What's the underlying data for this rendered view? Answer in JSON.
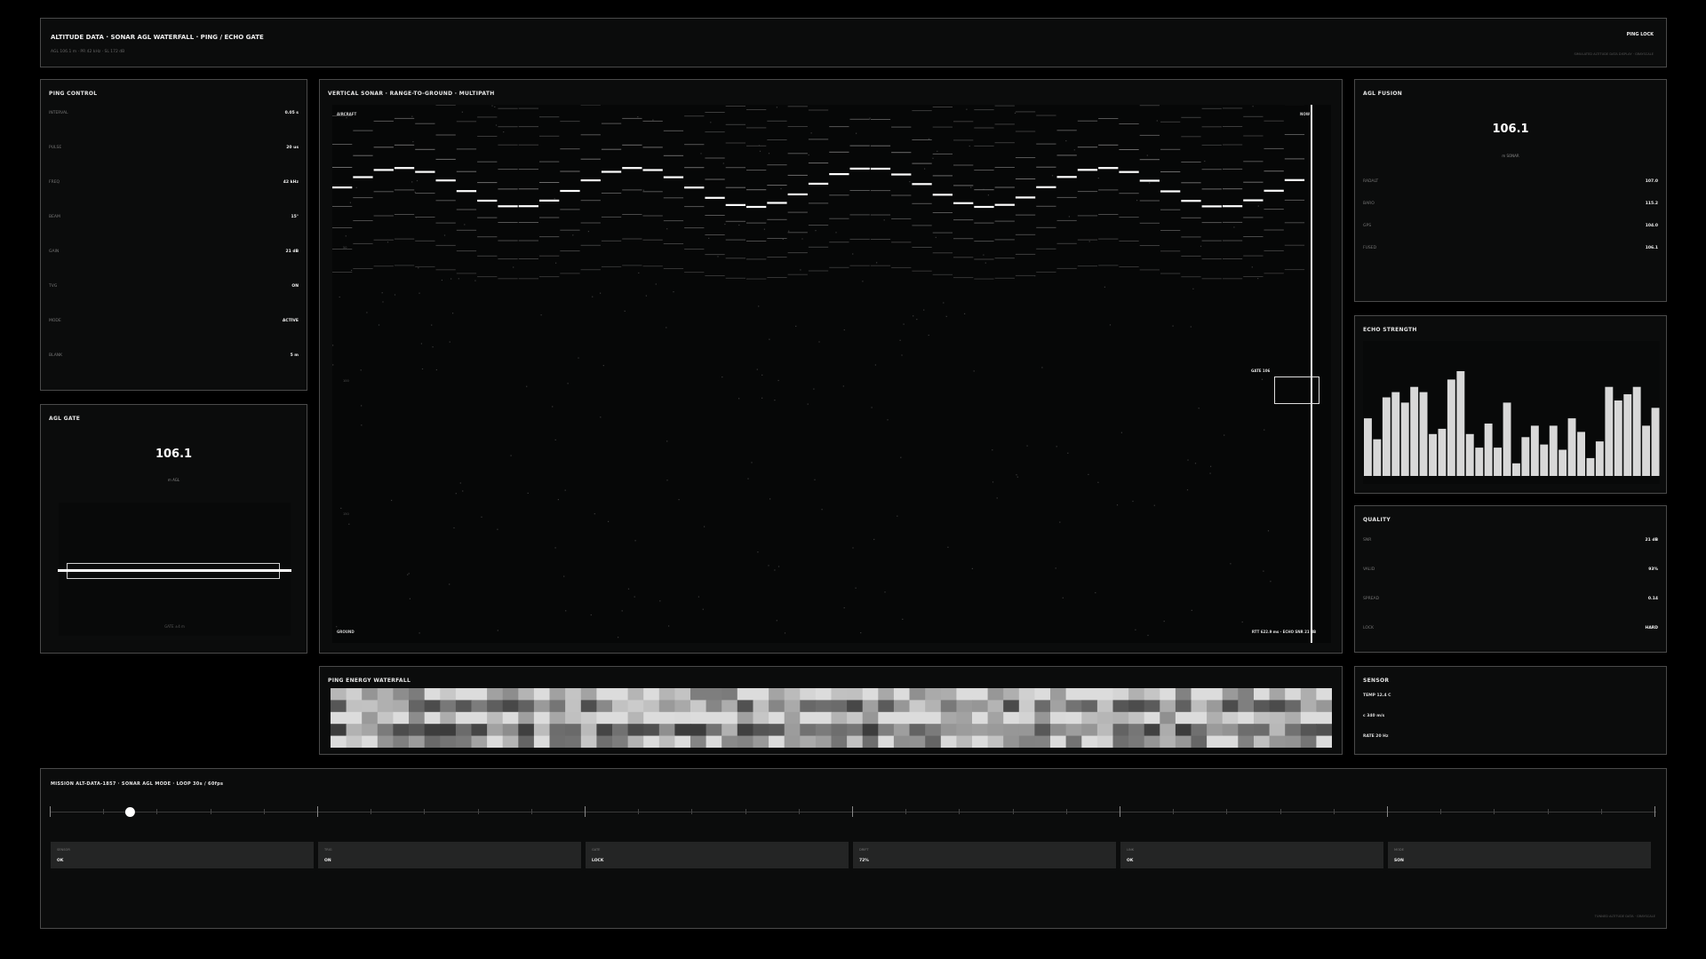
{
  "header": {
    "title": "ALTITUDE DATA · SONAR AGL WATERFALL · PING / ECHO GATE",
    "subtitle": "AGL 106.1 m · PR 42 kHz · SL 172 dB",
    "status": "PING LOCK",
    "right_caption": "SIMULATED ALTITUDE DATA DISPLAY · GRAYSCALE"
  },
  "ping_control": {
    "title": "PING CONTROL",
    "rows": [
      {
        "k": "INTERVAL",
        "v": "0.05 s"
      },
      {
        "k": "PULSE",
        "v": "20 us"
      },
      {
        "k": "FREQ",
        "v": "42 kHz"
      },
      {
        "k": "BEAM",
        "v": "15°"
      },
      {
        "k": "GAIN",
        "v": "21 dB"
      },
      {
        "k": "TVG",
        "v": "ON"
      },
      {
        "k": "MODE",
        "v": "ACTIVE"
      },
      {
        "k": "BLANK",
        "v": "5 m"
      }
    ]
  },
  "agl_gate": {
    "title": "AGL GATE",
    "value": "106.1",
    "unit": "m AGL",
    "caption": "GATE ±4 m"
  },
  "sonar": {
    "title": "VERTICAL SONAR · RANGE-TO-GROUND · MULTIPATH",
    "top_left": "AIRCRAFT",
    "top_right": "NOW",
    "bottom_left": "GROUND",
    "gate_label": "GATE 106",
    "readout": "RTT 622.9 ms · ECHO SNR 21 dB",
    "ticks": [
      "0",
      "50",
      "100",
      "150",
      "200"
    ]
  },
  "agl_fusion": {
    "title": "AGL FUSION",
    "value": "106.1",
    "unit": "m SONAR",
    "rows": [
      {
        "k": "RADALT",
        "v": "107.0"
      },
      {
        "k": "BARO",
        "v": "115.2"
      },
      {
        "k": "GPS",
        "v": "104.0"
      },
      {
        "k": "FUSED",
        "v": "106.1"
      }
    ]
  },
  "echo_strength": {
    "title": "ECHO STRENGTH",
    "values": [
      0.55,
      0.35,
      0.75,
      0.8,
      0.7,
      0.85,
      0.8,
      0.4,
      0.45,
      0.92,
      1.0,
      0.4,
      0.27,
      0.5,
      0.27,
      0.7,
      0.12,
      0.37,
      0.48,
      0.3,
      0.48,
      0.25,
      0.55,
      0.42,
      0.17,
      0.33,
      0.85,
      0.72,
      0.78,
      0.85,
      0.48,
      0.65
    ]
  },
  "quality": {
    "title": "QUALITY",
    "rows": [
      {
        "k": "SNR",
        "v": "21 dB"
      },
      {
        "k": "VALID",
        "v": "93%"
      },
      {
        "k": "SPREAD",
        "v": "0.14"
      },
      {
        "k": "LOCK",
        "v": "HARD"
      }
    ]
  },
  "energy": {
    "title": "PING ENERGY WATERFALL"
  },
  "sensor": {
    "title": "SENSOR",
    "lines": [
      "TEMP 12.4 C",
      "c 340 m/s",
      "RATE 20 Hz"
    ]
  },
  "mission": {
    "title": "MISSION ALT-DATA-1857 · SONAR AGL MODE · LOOP 30s / 60fps",
    "progress": 0.05,
    "cards": [
      {
        "k": "SENSOR",
        "v": "OK"
      },
      {
        "k": "TRIG",
        "v": "ON"
      },
      {
        "k": "GATE",
        "v": "LOCK"
      },
      {
        "k": "DRIFT",
        "v": "72%"
      },
      {
        "k": "LINK",
        "v": "OK"
      },
      {
        "k": "MODE",
        "v": "SON"
      }
    ],
    "footer": "TUNNED ALTITUDE DATA · GRAYSCALE"
  }
}
